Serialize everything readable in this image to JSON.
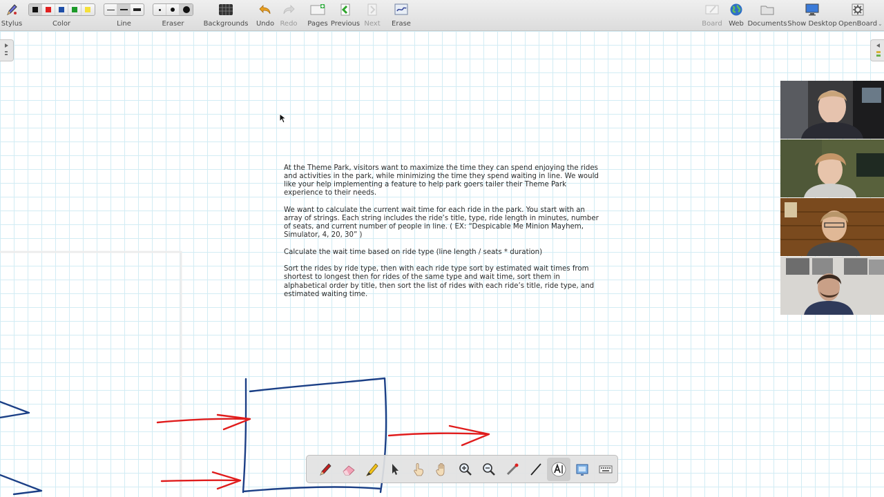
{
  "toolbar": {
    "stylus_label": "Stylus",
    "color_label": "Color",
    "line_label": "Line",
    "eraser_label": "Eraser",
    "backgrounds_label": "Backgrounds",
    "undo_label": "Undo",
    "redo_label": "Redo",
    "pages_label": "Pages",
    "previous_label": "Previous",
    "next_label": "Next",
    "erase_label": "Erase",
    "board_label": "Board",
    "web_label": "Web",
    "documents_label": "Documents",
    "show_desktop_label": "Show Desktop",
    "openboard_label": "OpenBoard",
    "colors": [
      "#111111",
      "#e02020",
      "#1f4fa8",
      "#1d9a2a",
      "#f5e03a"
    ],
    "selected_color_index": 0
  },
  "problem": {
    "p1": "At the Theme Park, visitors want to maximize the time they can spend enjoying the rides and activities in the park, while minimizing the time they spend waiting in line. We would like your help implementing a feature to help park goers tailer their Theme Park experience to their needs.",
    "p2": "We want to calculate the current wait time for each ride in the park. You start with an array of strings. Each string includes the ride’s title, type, ride length in minutes, number of seats, and current number of people in line. ( EX: “Despicable Me Minion Mayhem, Simulator, 4, 20, 30” )",
    "p3": "Calculate the wait time based on ride type (line length / seats * duration)",
    "p4": "Sort the rides by ride type, then with each ride type sort by estimated wait times from shortest to longest then for rides of the same type and wait time, sort them in alphabetical order by title, then sort the list of rides with each ride’s title, ride type, and estimated waiting time."
  },
  "ink_colors": {
    "blue": "#1b3f86",
    "red": "#e01c1c"
  },
  "video_participants": 4
}
